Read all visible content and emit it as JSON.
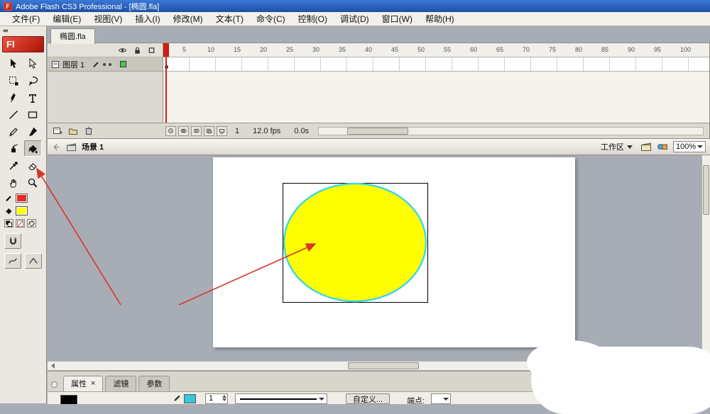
{
  "window": {
    "title": "Adobe Flash CS3 Professional - [椭圆.fla]",
    "app_initial": "F"
  },
  "menu": {
    "items": [
      "文件(F)",
      "编辑(E)",
      "视图(V)",
      "插入(I)",
      "修改(M)",
      "文本(T)",
      "命令(C)",
      "控制(O)",
      "调试(D)",
      "窗口(W)",
      "帮助(H)"
    ]
  },
  "document_tab": {
    "label": "椭圆.fla"
  },
  "tool_panel": {
    "logo": "Fl",
    "tools": [
      "selection",
      "subselection",
      "free-transform",
      "lasso",
      "pen",
      "text",
      "line",
      "rectangle",
      "pencil",
      "brush",
      "ink-bottle",
      "paint-bucket",
      "eyedropper",
      "eraser",
      "hand",
      "zoom"
    ],
    "stroke_swatch": "#e62b26",
    "fill_swatch": "#ffff00"
  },
  "timeline": {
    "layer": {
      "name": "图层 1",
      "outline_color": "#44cc44"
    },
    "ruler_ticks": [
      "5",
      "10",
      "15",
      "20",
      "25",
      "30",
      "35",
      "40",
      "45",
      "50",
      "55",
      "60",
      "65",
      "70",
      "75",
      "80",
      "85",
      "90",
      "95",
      "100"
    ],
    "status": {
      "current_frame": "1",
      "frame_rate": "12.0 fps",
      "elapsed_time": "0.0s"
    }
  },
  "edit_bar": {
    "scene_label": "场景 1",
    "workspace_label": "工作区",
    "zoom_value": "100%"
  },
  "stage": {
    "shape_fill": "#ffff00",
    "shape_stroke": "#3fd8e2",
    "shape_outline": "#000000"
  },
  "annotation": {
    "arrow_color": "#d8352b"
  },
  "properties_panel": {
    "tabs": [
      {
        "label": "属性"
      },
      {
        "label": "滤镜"
      },
      {
        "label": "参数"
      }
    ],
    "close_label": "×",
    "stroke_swatch": "#33c9da",
    "stroke_height": "1",
    "custom_button": "自定义...",
    "cap_label": "端点:"
  }
}
